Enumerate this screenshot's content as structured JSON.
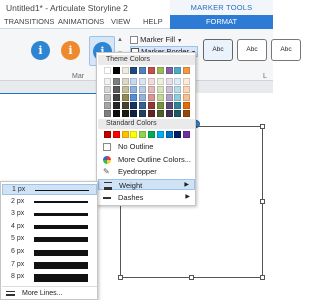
{
  "window": {
    "title": "Untitled1* - Articulate Storyline 2",
    "context_label": "MARKER TOOLS"
  },
  "tabs": [
    "TRANSITIONS",
    "ANIMATIONS",
    "VIEW",
    "HELP"
  ],
  "active_tab": "FORMAT",
  "ribbon": {
    "group_label": "Mar",
    "marker_fill": "Marker Fill",
    "marker_border": "Marker Border",
    "marker_styles": [
      {
        "glyph": "i",
        "color": "#2e86d2"
      },
      {
        "glyph": "i",
        "color": "#ee8a2e"
      },
      {
        "glyph": "i",
        "color": "#2e86d2"
      }
    ],
    "callout_label": "Abc",
    "right_group_label": "L"
  },
  "menu": {
    "theme_colors_header": "Theme Colors",
    "theme_top_row": [
      "#ffffff",
      "#000000",
      "#eeece1",
      "#1f497d",
      "#4f81bd",
      "#c0504d",
      "#9bbb59",
      "#8064a2",
      "#4bacc6",
      "#f79646"
    ],
    "theme_shades": [
      [
        "#f2f2f2",
        "#7f7f7f",
        "#ddd9c3",
        "#c6d9f0",
        "#dbe5f1",
        "#f2dcdb",
        "#ebf1dd",
        "#e5e0ec",
        "#dbeef3",
        "#fdeada"
      ],
      [
        "#d8d8d8",
        "#595959",
        "#c4bd97",
        "#8db3e2",
        "#b8cce4",
        "#e5b9b7",
        "#d7e3bc",
        "#ccc1d9",
        "#b7dde8",
        "#fbd5b5"
      ],
      [
        "#bfbfbf",
        "#3f3f3f",
        "#938953",
        "#548dd4",
        "#95b3d7",
        "#d99694",
        "#c3d69b",
        "#b2a2c7",
        "#92cddc",
        "#fac08f"
      ],
      [
        "#a5a5a5",
        "#262626",
        "#494429",
        "#17365d",
        "#366092",
        "#953734",
        "#76923c",
        "#5f497a",
        "#31859b",
        "#e36c09"
      ],
      [
        "#7f7f7f",
        "#0c0c0c",
        "#1d1b10",
        "#0f243e",
        "#244061",
        "#632423",
        "#4f6128",
        "#3f3151",
        "#205867",
        "#974806"
      ]
    ],
    "standard_colors_header": "Standard Colors",
    "standard_colors": [
      "#c00000",
      "#ff0000",
      "#ffc000",
      "#ffff00",
      "#92d050",
      "#00b050",
      "#00b0f0",
      "#0070c0",
      "#002060",
      "#7030a0"
    ],
    "no_outline": "No Outline",
    "more_outline_colors": "More Outline Colors...",
    "eyedropper": "Eyedropper",
    "weight": "Weight",
    "dashes": "Dashes"
  },
  "weight_menu": {
    "options": [
      "1 px",
      "2 px",
      "3 px",
      "4 px",
      "5 px",
      "6 px",
      "7 px",
      "8 px"
    ],
    "selected": "1 px",
    "more_lines": "More Lines..."
  }
}
